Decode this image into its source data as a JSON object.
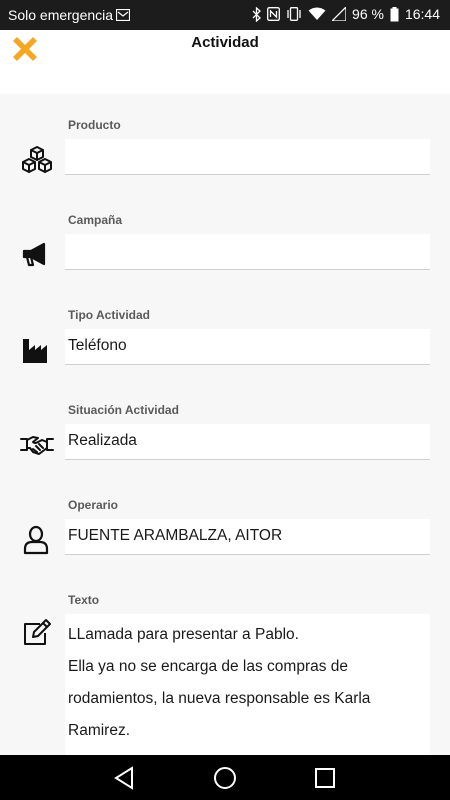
{
  "status_bar": {
    "carrier": "Solo emergencia",
    "battery": "96 %",
    "time": "16:44"
  },
  "header": {
    "title": "Actividad",
    "close_icon": "close-icon",
    "close_color": "#F5A623"
  },
  "fields": {
    "producto": {
      "label": "Producto",
      "value": "",
      "icon": "boxes-icon"
    },
    "campana": {
      "label": "Campaña",
      "value": "",
      "icon": "megaphone-icon"
    },
    "tipo_actividad": {
      "label": "Tipo Actividad",
      "value": "Teléfono",
      "icon": "factory-icon"
    },
    "situacion_actividad": {
      "label": "Situación Actividad",
      "value": "Realizada",
      "icon": "handshake-icon"
    },
    "operario": {
      "label": "Operario",
      "value": "FUENTE ARAMBALZA, AITOR",
      "icon": "user-icon"
    },
    "texto": {
      "label": "Texto",
      "icon": "edit-icon",
      "lines": [
        "LLamada para presentar a Pablo.",
        "Ella ya no se encarga de las compras de",
        "rodamientos, la nueva responsable es Karla",
        "Ramirez."
      ]
    }
  },
  "nav_bar": {
    "back_icon": "back-triangle-icon",
    "home_icon": "home-circle-icon",
    "recents_icon": "recents-square-icon"
  }
}
